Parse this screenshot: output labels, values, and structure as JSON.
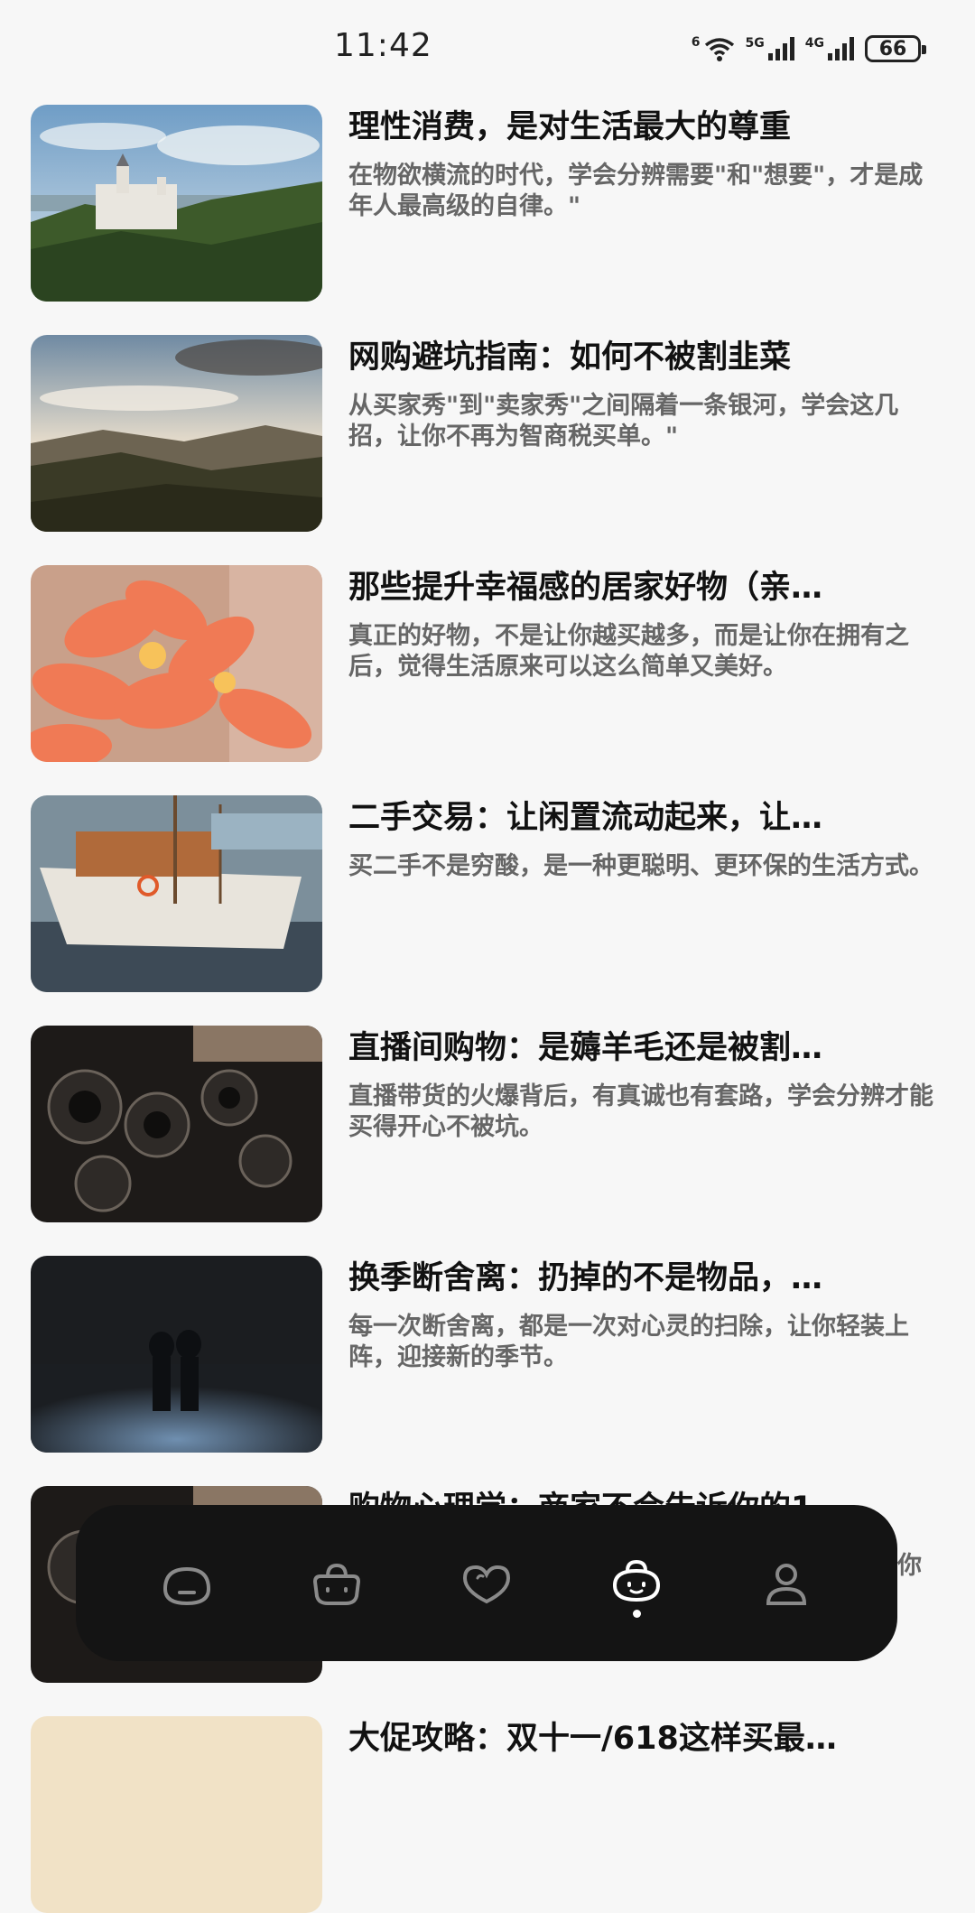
{
  "status": {
    "time": "11:42",
    "wifi_tag": "6",
    "sim1_tag": "5G",
    "sim2_tag": "4G",
    "battery": "66"
  },
  "articles": [
    {
      "title": "理性消费，是对生活最大的尊重",
      "desc": "在物欲横流的时代，学会分辨需要\"和\"想要\"，才是成年人最高级的自律。\"",
      "image": "castle-landscape"
    },
    {
      "title": "网购避坑指南：如何不被割韭菜",
      "desc": "从买家秀\"到\"卖家秀\"之间隔着一条银河，学会这几招，让你不再为智商税买单。\"",
      "image": "hills-landscape"
    },
    {
      "title": "那些提升幸福感的居家好物（亲…",
      "desc": "真正的好物，不是让你越买越多，而是让你在拥有之后，觉得生活原来可以这么简单又美好。",
      "image": "orange-flowers"
    },
    {
      "title": "二手交易：让闲置流动起来，让…",
      "desc": "买二手不是穷酸，是一种更聪明、更环保的生活方式。",
      "image": "sailboat-harbor"
    },
    {
      "title": "直播间购物：是薅羊毛还是被割…",
      "desc": "直播带货的火爆背后，有真诚也有套路，学会分辨才能买得开心不被坑。",
      "image": "vintage-cameras"
    },
    {
      "title": "换季断舍离：扔掉的不是物品，…",
      "desc": "每一次断舍离，都是一次对心灵的扫除，让你轻装上阵，迎接新的季节。",
      "image": "couple-in-rain"
    },
    {
      "title": "购物心理学：商家不会告诉你的1…",
      "desc": "你",
      "image": "vintage-cameras"
    },
    {
      "title": "大促攻略：双十一/618这样买最…",
      "desc": "",
      "image": "warm-gradient"
    }
  ],
  "nav": {
    "items": [
      {
        "icon": "home-face-icon",
        "active": false
      },
      {
        "icon": "basket-icon",
        "active": false
      },
      {
        "icon": "heart-icon",
        "active": false
      },
      {
        "icon": "article-face-icon",
        "active": true
      },
      {
        "icon": "profile-icon",
        "active": false
      }
    ],
    "colors": {
      "active": "#ffffff",
      "inactive": "#8a8a8a"
    }
  }
}
